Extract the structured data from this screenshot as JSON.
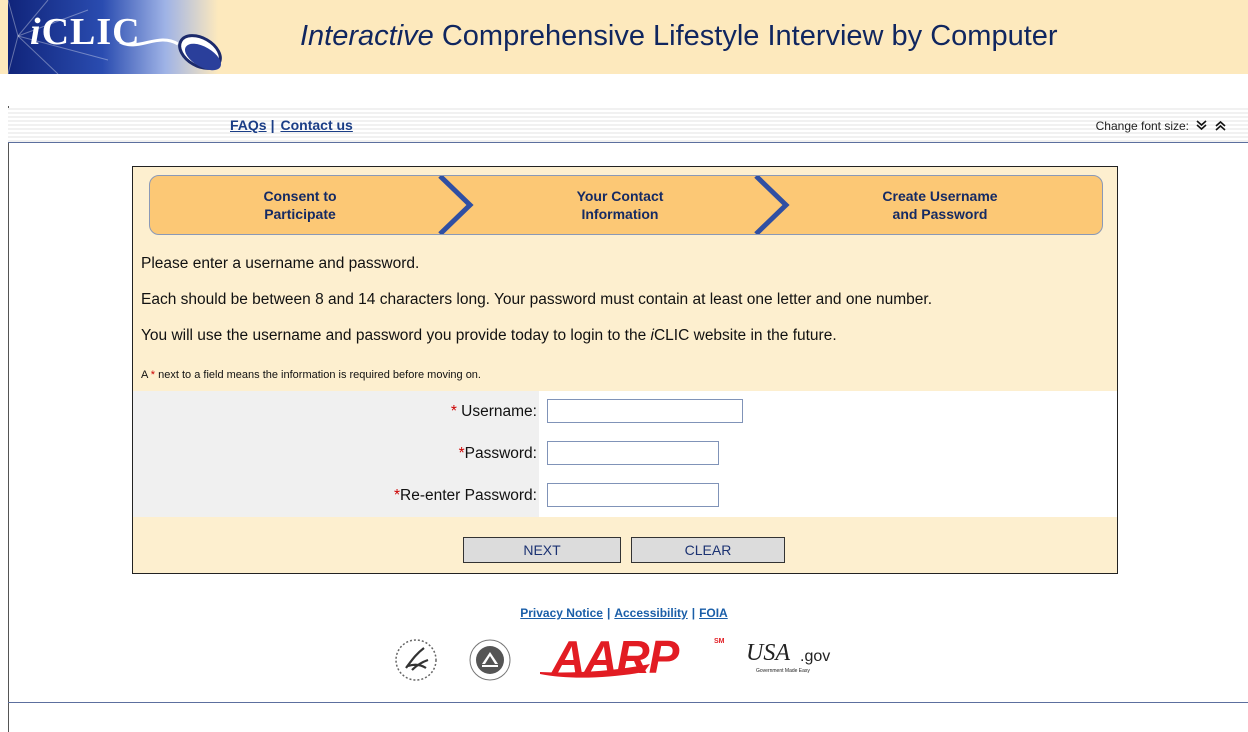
{
  "header": {
    "logo_prefix": "i",
    "logo_main": "CLIC",
    "title_italic": "Interactive",
    "title_rest": " Comprehensive Lifestyle Interview by Computer"
  },
  "utility": {
    "faqs": "FAQs",
    "contact": "Contact us",
    "separator": "|",
    "font_size_label": "Change font size:",
    "decrease_glyph": "≫",
    "increase_glyph": "≪"
  },
  "steps": [
    {
      "line1": "Consent to",
      "line2": "Participate"
    },
    {
      "line1": "Your Contact",
      "line2": "Information"
    },
    {
      "line1": "Create Username",
      "line2": "and Password"
    }
  ],
  "instructions": {
    "line1": "Please enter a username and password.",
    "line2": "Each should be between 8 and 14 characters long. Your password must contain at least one letter and one number.",
    "line3_pre": "You will use the username and password you provide today to login to the ",
    "line3_italic": "i",
    "line3_brand": "CLIC",
    "line3_post": " website in the future.",
    "note_pre": "A ",
    "note_star": "*",
    "note_post": " next to a field means the information is required before moving on."
  },
  "form": {
    "username_star": "*",
    "username_label": " Username:",
    "username_value": "",
    "password_star": "*",
    "password_label": "Password:",
    "password_value": "",
    "reenter_star": "*",
    "reenter_label": "Re-enter Password:",
    "reenter_value": ""
  },
  "buttons": {
    "next": "NEXT",
    "clear": "CLEAR"
  },
  "footer": {
    "privacy": "Privacy Notice",
    "accessibility": "Accessibility",
    "foia": "FOIA",
    "separator": "|",
    "aarp": "AARP",
    "aarp_sm": "SM",
    "usagov_main": "USA",
    "usagov_suffix": ".gov",
    "usagov_tagline": "Government Made Easy"
  },
  "colors": {
    "header_band": "#fde9bd",
    "panel_bg": "#fdefcf",
    "steps_bg": "#fcc875",
    "chevron": "#2f4fa3",
    "link": "#1a3d86",
    "required": "#cc0000",
    "aarp_red": "#e21c23"
  }
}
